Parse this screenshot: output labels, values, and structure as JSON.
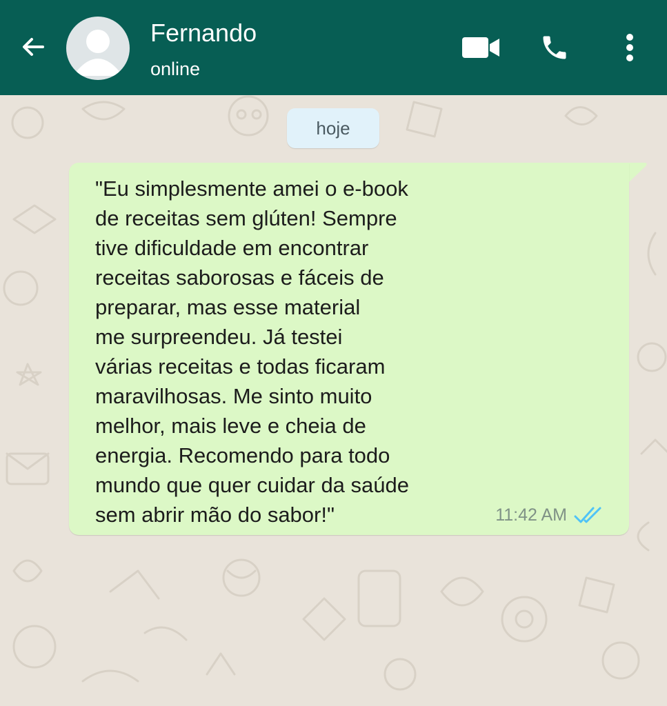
{
  "header": {
    "contact_name": "Fernando",
    "status": "online",
    "back_icon": "arrow-left-icon",
    "avatar_icon": "default-avatar-icon",
    "video_icon": "video-camera-icon",
    "call_icon": "phone-icon",
    "menu_icon": "more-vertical-icon"
  },
  "chat": {
    "date_label": "hoje",
    "messages": [
      {
        "direction": "outgoing",
        "lines": [
          "\"Eu simplesmente amei o e-book",
          "de receitas sem glúten! Sempre",
          "tive dificuldade em encontrar",
          "receitas saborosas e fáceis de",
          "preparar, mas esse material",
          "me surpreendeu. Já testei",
          "várias receitas e todas ficaram",
          "maravilhosas. Me sinto muito",
          "melhor, mais leve e cheia de",
          "energia. Recomendo para todo",
          "mundo que quer cuidar da saúde",
          "sem abrir mão do sabor!\""
        ],
        "time": "11:42 AM",
        "status_icon": "double-check-read-icon"
      }
    ]
  },
  "colors": {
    "header_bg": "#075e54",
    "bubble_bg": "#dcf8c6",
    "date_chip_bg": "#e1f2fa",
    "read_tick": "#4fc3f7",
    "wallpaper": "#e9e3da"
  }
}
